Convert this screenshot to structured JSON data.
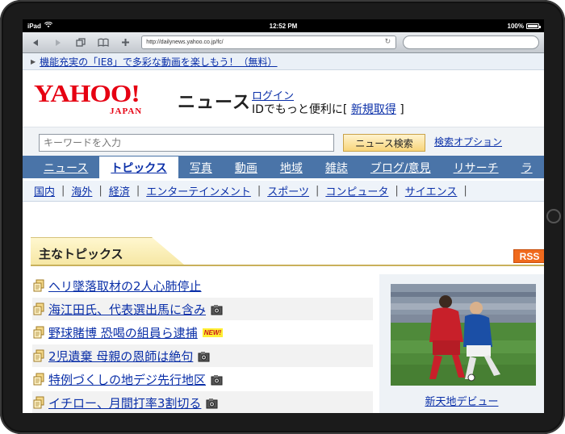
{
  "status_bar": {
    "device": "iPad",
    "time": "12:52 PM",
    "battery": "100%"
  },
  "browser": {
    "url": "http://dailynews.yahoo.co.jp/fc/",
    "search_placeholder": ""
  },
  "promo": {
    "text": "機能充実の「IE8」で多彩な動画を楽しもう！（無料）"
  },
  "header": {
    "logo_text": "YAHOO!",
    "logo_sub": "JAPAN",
    "section": "ニュース",
    "login": "ログイン",
    "id_prefix": "IDでもっと便利に[",
    "id_link": "新規取得",
    "id_suffix": "]"
  },
  "search": {
    "placeholder": "キーワードを入力",
    "button": "ニュース検索",
    "option": "検索オプション"
  },
  "main_nav": [
    {
      "label": "ニュース"
    },
    {
      "label": "トピックス"
    },
    {
      "label": "写真"
    },
    {
      "label": "動画"
    },
    {
      "label": "地域"
    },
    {
      "label": "雑誌"
    },
    {
      "label": "ブログ/意見"
    },
    {
      "label": "リサーチ"
    },
    {
      "label": "ラ"
    }
  ],
  "sub_nav": [
    {
      "label": "国内"
    },
    {
      "label": "海外"
    },
    {
      "label": "経済"
    },
    {
      "label": "エンターテインメント"
    },
    {
      "label": "スポーツ"
    },
    {
      "label": "コンピュータ"
    },
    {
      "label": "サイエンス"
    }
  ],
  "topics": {
    "title": "主なトピックス",
    "rss": "RSS",
    "items": [
      {
        "title": "ヘリ墜落取材の2人心肺停止",
        "camera": false,
        "new": false
      },
      {
        "title": "海江田氏、代表選出馬に含み",
        "camera": true,
        "new": false
      },
      {
        "title": "野球賭博 恐喝の組員ら逮捕",
        "camera": false,
        "new": true,
        "new_label": "NEW!"
      },
      {
        "title": "2児遺棄 母親の恩師は絶句",
        "camera": true,
        "new": false
      },
      {
        "title": "特例づくしの地デジ先行地区",
        "camera": true,
        "new": false
      },
      {
        "title": "イチロー、月間打率3割切る",
        "camera": true,
        "new": false
      }
    ]
  },
  "photo": {
    "caption": "新天地デビュー"
  },
  "colors": {
    "nav_bg": "#4a74a8",
    "link": "#0a2fa8",
    "yahoo_red": "#e60012",
    "rss_orange": "#f06a1d"
  }
}
